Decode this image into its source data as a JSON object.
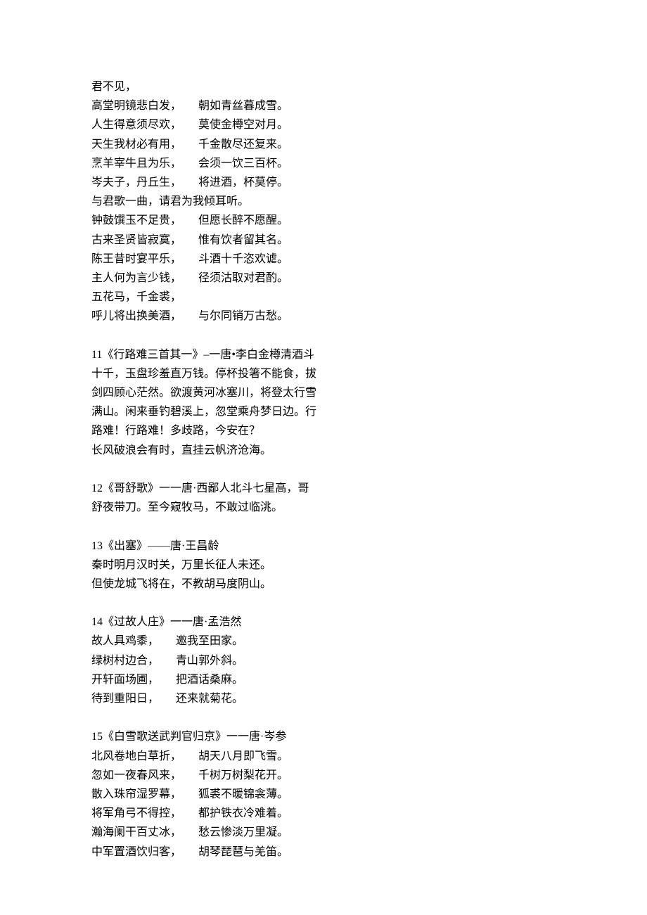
{
  "poem10": {
    "l0": "君不见，",
    "pairs": [
      [
        "高堂明镜悲白发，",
        "朝如青丝暮成雪。"
      ],
      [
        "人生得意须尽欢，",
        "莫使金樽空对月。"
      ],
      [
        "天生我材必有用，",
        "千金散尽还复来。"
      ],
      [
        "烹羊宰牛且为乐，",
        "会须一饮三百杯。"
      ],
      [
        "岑夫子，丹丘生，",
        "将进酒，杯莫停。"
      ]
    ],
    "single1": "与君歌一曲，请君为我倾耳听。",
    "pairs2": [
      [
        "钟鼓馔玉不足贵，",
        "但愿长醉不愿醒。"
      ],
      [
        "古来圣贤皆寂寞，",
        "惟有饮者留其名。"
      ],
      [
        "陈王昔时宴平乐，",
        "斗酒十千恣欢谑。"
      ],
      [
        "主人何为言少钱，",
        "径须沽取对君酌。"
      ]
    ],
    "single2": "五花马，千金裘，",
    "pairs3": [
      [
        "呼儿将出换美酒，",
        "与尔同销万古愁。"
      ]
    ]
  },
  "poem11": {
    "lines": [
      "11《行路难三首其一》–一唐•李白金樽清酒斗",
      "十千，玉盘珍羞直万钱。停杯投箸不能食，拔",
      "剑四顾心茫然。欲渡黄河冰塞川，将登太行雪",
      "满山。闲来垂钓碧溪上，忽堂乘舟梦日边。行",
      "路难！行路难！多歧路，今安在？",
      "长风破浪会有时，直挂云帆济沧海。"
    ]
  },
  "poem12": {
    "lines": [
      "12《哥舒歌》一一唐·西鄙人北斗七星高，哥",
      "舒夜带刀。至今窥牧马，不敢过临洮。"
    ]
  },
  "poem13": {
    "title": "13《出塞》——唐·王昌龄",
    "lines": [
      "秦时明月汉时关，万里长征人未还。",
      "但使龙城飞将在，不教胡马度阴山。"
    ]
  },
  "poem14": {
    "title": "14《过故人庄》一一唐·孟浩然",
    "pairs": [
      [
        "故人具鸡黍，",
        "邀我至田家。"
      ],
      [
        "绿树村边合，",
        "青山郭外斜。"
      ],
      [
        "开轩面场圃，",
        "把酒话桑麻。"
      ],
      [
        "待到重阳日，",
        "还来就菊花。"
      ]
    ]
  },
  "poem15": {
    "title": "15《白雪歌送武判官归京》一一唐·岑参",
    "pairs": [
      [
        "北风卷地白草折，",
        "胡天八月即飞雪。"
      ],
      [
        "忽如一夜春风来，",
        "千树万树梨花开。"
      ],
      [
        "散入珠帘湿罗幕，",
        "狐裘不暖锦衾薄。"
      ],
      [
        "将军角弓不得控，",
        "都护铁衣冷难着。"
      ],
      [
        "瀚海阑干百丈冰，",
        "愁云惨淡万里凝。"
      ],
      [
        "中军置酒饮归客，",
        "胡琴琵琶与羌笛。"
      ]
    ]
  }
}
